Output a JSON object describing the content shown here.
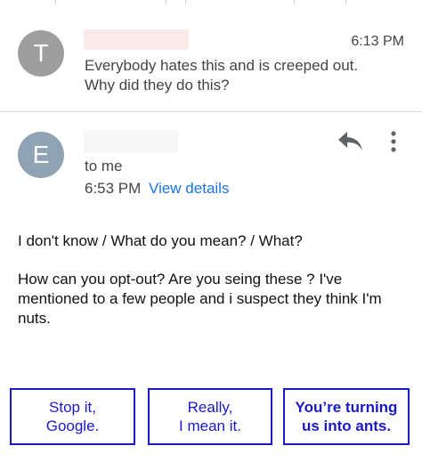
{
  "thread": {
    "message1": {
      "avatar_letter": "T",
      "avatar_color": "#9e9e9e",
      "time": "6:13 PM",
      "snippet_line1": "Everybody hates this and is creeped out.",
      "snippet_line2": "Why did they do this?"
    },
    "message2": {
      "avatar_letter": "E",
      "avatar_color": "#8fa3b4",
      "to": "to me",
      "time": "6:53 PM",
      "view_details": "View details",
      "body_paragraph1": "I don't know / What do you mean? / What?",
      "body_paragraph2": "How can you opt-out? Are you seing these ? I've mentioned to a few people and i suspect they think I'm nuts."
    }
  },
  "icons": {
    "reply": "reply-icon",
    "more": "more-vert-icon"
  },
  "smart_replies": [
    {
      "label": "Stop it,\nGoogle."
    },
    {
      "label": "Really,\nI mean it."
    },
    {
      "label": "You’re turning\nus into ants."
    }
  ],
  "colors": {
    "link": "#1a73e8",
    "smart_reply_border": "#1a19c8",
    "redaction": "#fbeaea"
  }
}
